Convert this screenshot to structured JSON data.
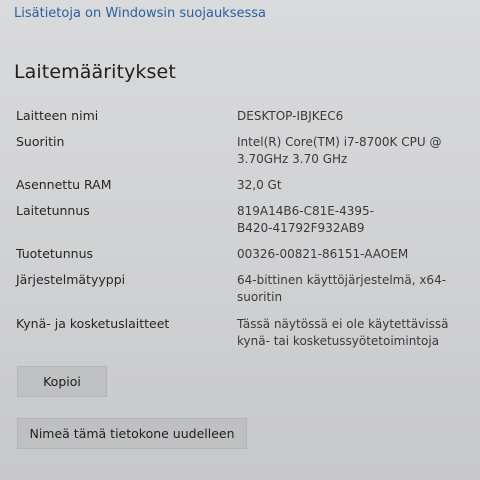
{
  "header": {
    "security_link": "Lisätietoja on Windowsin suojauksessa"
  },
  "section": {
    "title": "Laitemääritykset"
  },
  "specs": [
    {
      "label": "Laitteen nimi",
      "value": "DESKTOP-IBJKEC6"
    },
    {
      "label": "Suoritin",
      "value": "Intel(R) Core(TM) i7-8700K CPU @ 3.70GHz   3.70 GHz"
    },
    {
      "label": "Asennettu RAM",
      "value": "32,0 Gt"
    },
    {
      "label": "Laitetunnus",
      "value": "819A14B6-C81E-4395-B420-41792F932AB9"
    },
    {
      "label": "Tuotetunnus",
      "value": "00326-00821-86151-AAOEM"
    },
    {
      "label": "Järjestelmätyyppi",
      "value": "64-bittinen käyttöjärjestelmä, x64-suoritin"
    },
    {
      "label": "Kynä- ja kosketuslaitteet",
      "value": "Tässä näytössä ei ole käytettävissä kynä- tai kosketussyötetoimintoja"
    }
  ],
  "buttons": {
    "copy_label": "Kopioi",
    "rename_label": "Nimeä tämä tietokone uudelleen"
  }
}
